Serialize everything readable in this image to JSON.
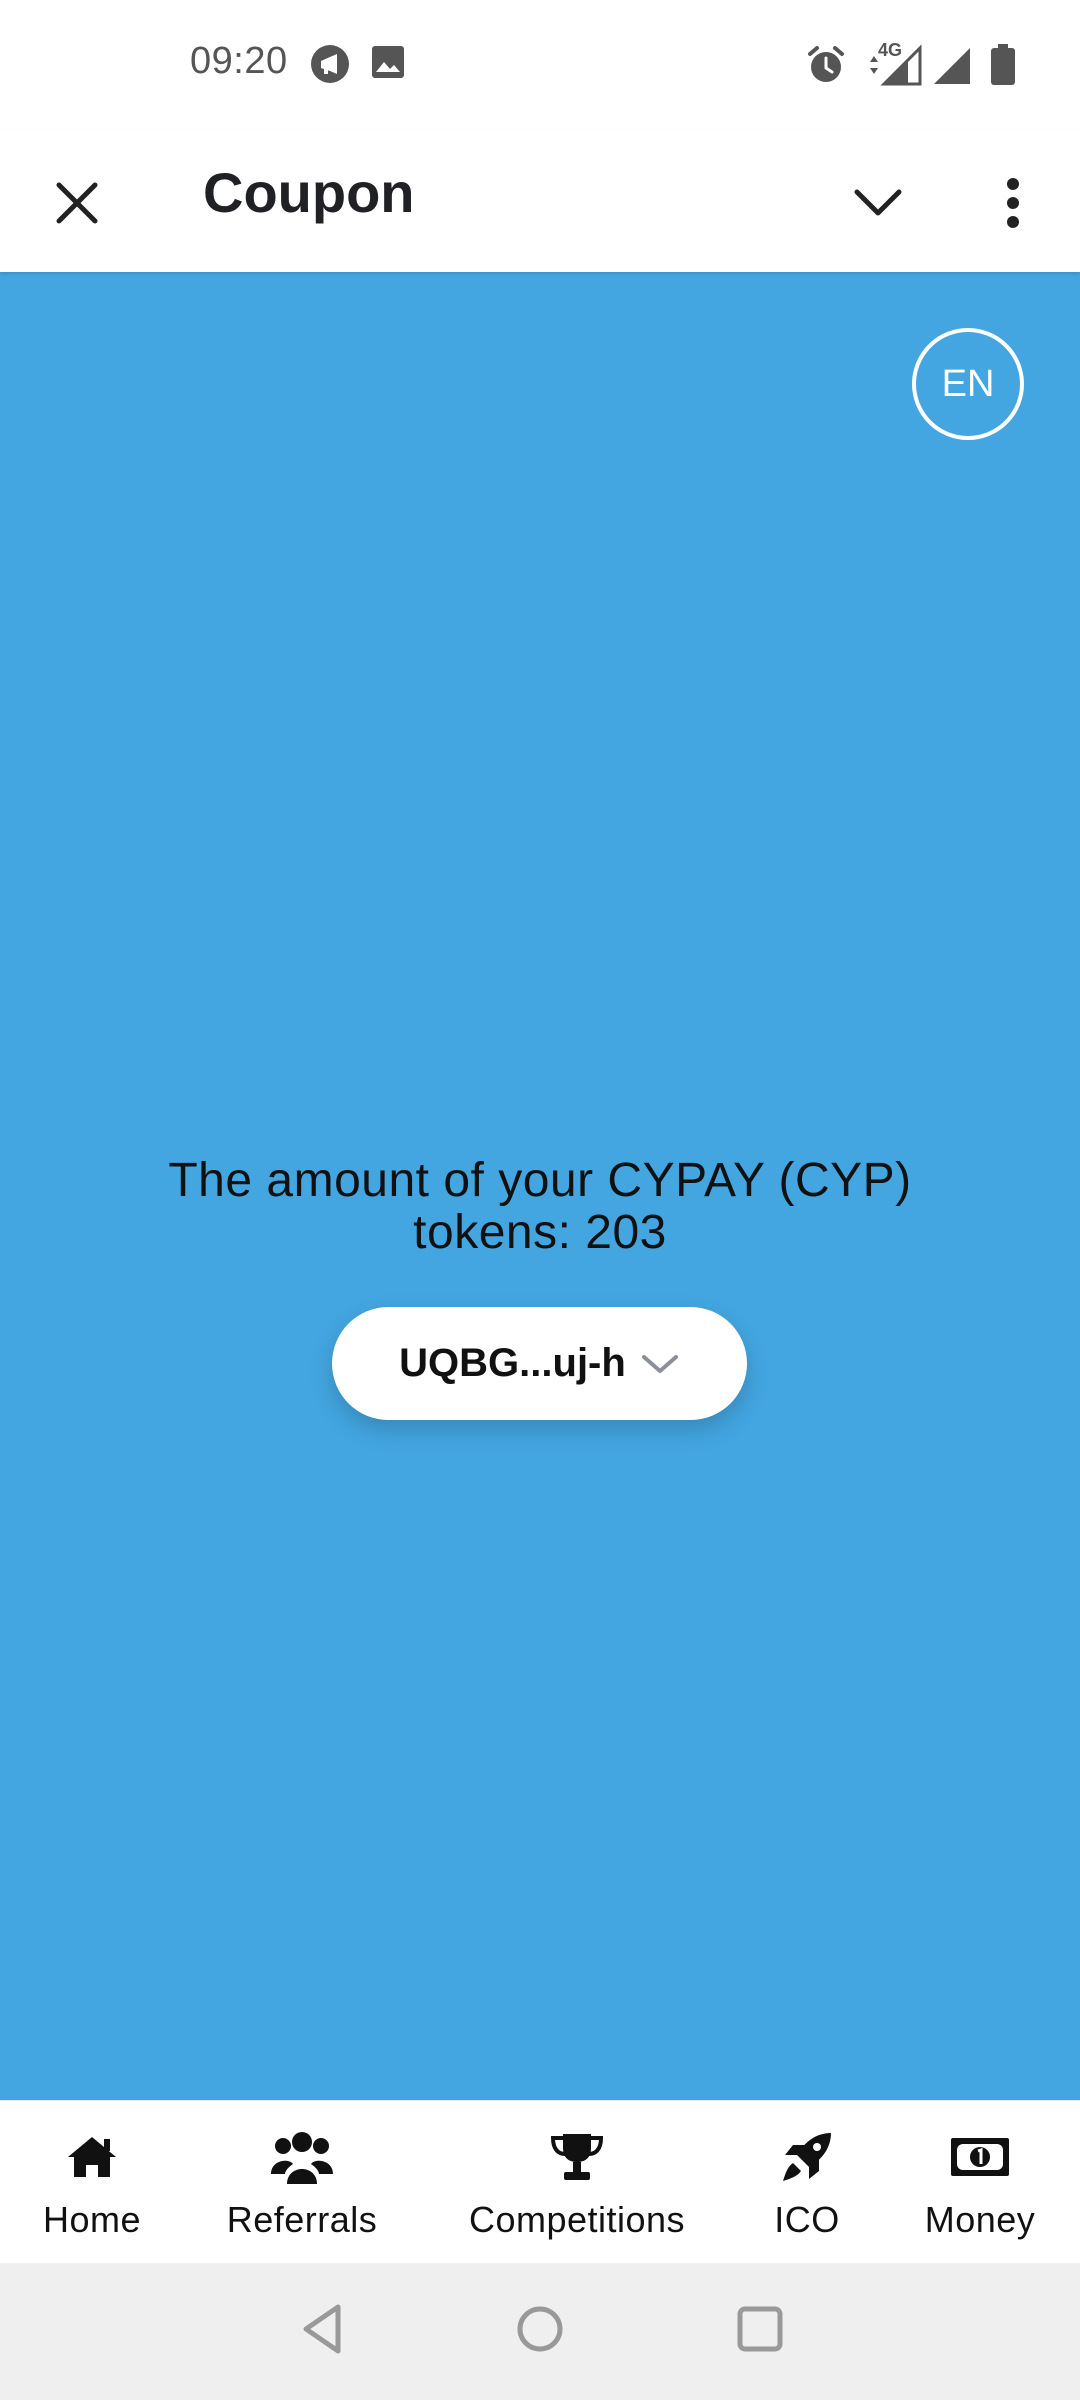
{
  "status_bar": {
    "time": "09:20",
    "network": "4G",
    "icons": [
      "megaphone-icon",
      "image-icon",
      "alarm-icon",
      "signal-4g-icon",
      "signal-icon",
      "battery-icon"
    ]
  },
  "app_bar": {
    "title": "Coupon",
    "icons": [
      "close-icon",
      "chevron-down-icon",
      "more-vert-icon"
    ]
  },
  "main": {
    "background": "#43a6e1",
    "language": "EN",
    "amount_line1": "The amount of your CYPAY (CYP)",
    "amount_line2": "tokens: 203",
    "wallet_address": "UQBG...uj-h"
  },
  "tabs": [
    {
      "label": "Home",
      "icon": "home-icon"
    },
    {
      "label": "Referrals",
      "icon": "users-icon"
    },
    {
      "label": "Competitions",
      "icon": "trophy-icon"
    },
    {
      "label": "ICO",
      "icon": "rocket-icon"
    },
    {
      "label": "Money",
      "icon": "money-icon"
    }
  ],
  "system_nav": {
    "icons": [
      "back-icon",
      "home-circle-icon",
      "recents-icon"
    ]
  }
}
